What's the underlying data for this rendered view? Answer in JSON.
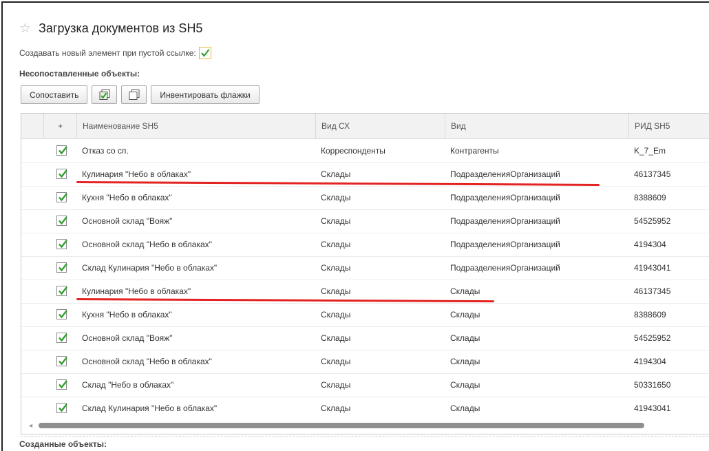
{
  "window": {
    "title": "Загрузка документов из SH5"
  },
  "options": {
    "create_new_label": "Создавать новый элемент при пустой ссылке:",
    "create_new_checked": true
  },
  "unmatched": {
    "label": "Несопоставленные объекты:"
  },
  "toolbar": {
    "match_label": "Сопоставить",
    "check_all_icon": "check-all-icon",
    "uncheck_all_icon": "uncheck-all-icon",
    "invert_label": "Инвентировать флажки"
  },
  "grid": {
    "columns": {
      "add": "+",
      "name": "Наименование SH5",
      "vid_sx": "Вид СХ",
      "vid": "Вид",
      "rid": "РИД SH5"
    },
    "rows": [
      {
        "checked": true,
        "name": "Отказ со сп.",
        "vid_sx": "Корреспонденты",
        "vid": "Контрагенты",
        "rid": "K_7_Em"
      },
      {
        "checked": true,
        "name": "Кулинария \"Небо в облаках\"",
        "vid_sx": "Склады",
        "vid": "ПодразделенияОрганизаций",
        "rid": "46137345"
      },
      {
        "checked": true,
        "name": "Кухня \"Небо в облаках\"",
        "vid_sx": "Склады",
        "vid": "ПодразделенияОрганизаций",
        "rid": "8388609"
      },
      {
        "checked": true,
        "name": "Основной склад \"Вояж\"",
        "vid_sx": "Склады",
        "vid": "ПодразделенияОрганизаций",
        "rid": "54525952"
      },
      {
        "checked": true,
        "name": "Основной склад \"Небо в облаках\"",
        "vid_sx": "Склады",
        "vid": "ПодразделенияОрганизаций",
        "rid": "4194304"
      },
      {
        "checked": true,
        "name": "Склад Кулинария \"Небо в облаках\"",
        "vid_sx": "Склады",
        "vid": "ПодразделенияОрганизаций",
        "rid": "41943041"
      },
      {
        "checked": true,
        "name": "Кулинария \"Небо в облаках\"",
        "vid_sx": "Склады",
        "vid": "Склады",
        "rid": "46137345"
      },
      {
        "checked": true,
        "name": "Кухня \"Небо в облаках\"",
        "vid_sx": "Склады",
        "vid": "Склады",
        "rid": "8388609"
      },
      {
        "checked": true,
        "name": "Основной склад \"Вояж\"",
        "vid_sx": "Склады",
        "vid": "Склады",
        "rid": "54525952"
      },
      {
        "checked": true,
        "name": "Основной склад \"Небо в облаках\"",
        "vid_sx": "Склады",
        "vid": "Склады",
        "rid": "4194304"
      },
      {
        "checked": true,
        "name": "Склад \"Небо в облаках\"",
        "vid_sx": "Склады",
        "vid": "Склады",
        "rid": "50331650"
      },
      {
        "checked": true,
        "name": "Склад Кулинария \"Небо в облаках\"",
        "vid_sx": "Склады",
        "vid": "Склады",
        "rid": "41943041"
      }
    ],
    "highlighted_rows": [
      1,
      6
    ]
  },
  "created": {
    "label": "Созданные объекты:"
  },
  "colors": {
    "checkmark": "#2f9e2f",
    "highlight_underline": "#e32222",
    "checkbox_focus_border": "#e8b53a"
  }
}
